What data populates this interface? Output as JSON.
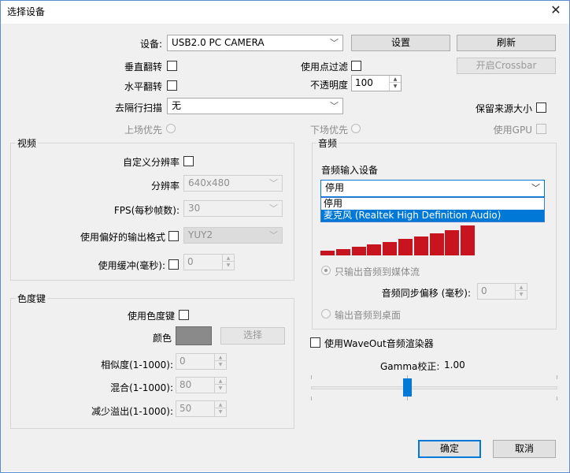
{
  "window": {
    "title": "选择设备",
    "close_symbol": "✕"
  },
  "device": {
    "label": "设备:",
    "value": "USB2.0 PC CAMERA",
    "settings_button": "设置",
    "refresh_button": "刷新",
    "crossbar_button": "开启Crossbar"
  },
  "options": {
    "vflip_label": "垂直翻转",
    "hflip_label": "水平翻转",
    "point_filter_label": "使用点过滤",
    "opacity_label": "不透明度",
    "opacity_value": "100",
    "deinterlace_label": "去隔行扫描",
    "deinterlace_value": "无",
    "keep_source_size_label": "保留来源大小",
    "upper_first_label": "上场优先",
    "lower_first_label": "下场优先",
    "use_gpu_label": "使用GPU"
  },
  "video": {
    "group_title": "视频",
    "custom_res_label": "自定义分辨率",
    "resolution_label": "分辨率",
    "resolution_value": "640x480",
    "fps_label": "FPS(每秒帧数):",
    "fps_value": "30",
    "preferred_format_label": "使用偏好的输出格式",
    "format_value": "YUY2",
    "buffer_label": "使用缓冲(毫秒):",
    "buffer_value": "0"
  },
  "audio": {
    "group_title": "音频",
    "input_device_label": "音频输入设备",
    "input_device_value": "停用",
    "dropdown_options": [
      "停用",
      "麦克风 (Realtek High Definition Audio)"
    ],
    "output_stream_only_label": "只输出音频到媒体流",
    "sync_offset_label": "音频同步偏移 (毫秒):",
    "sync_offset_value": "0",
    "output_desktop_label": "输出音频到桌面",
    "meter_levels": [
      0.16,
      0.22,
      0.29,
      0.37,
      0.45,
      0.54,
      0.63,
      0.73,
      0.84,
      1.0
    ]
  },
  "chroma": {
    "group_title": "色度键",
    "use_chroma_label": "使用色度键",
    "color_label": "颜色",
    "color_swatch": "#8a8a8a",
    "select_button": "选择",
    "similarity_label": "相似度(1-1000):",
    "similarity_value": "0",
    "blend_label": "混合(1-1000):",
    "blend_value": "80",
    "spill_label": "减少溢出(1-1000):",
    "spill_value": "50"
  },
  "waveout": {
    "use_waveout_label": "使用WaveOut音频渲染器",
    "gamma_label": "Gamma校正:",
    "gamma_value": "1.00"
  },
  "footer": {
    "ok_button": "确定",
    "cancel_button": "取消"
  },
  "colors": {
    "accent": "#0078d7",
    "meter": "#c8141e",
    "dialog_bg": "#f0f0f0"
  }
}
